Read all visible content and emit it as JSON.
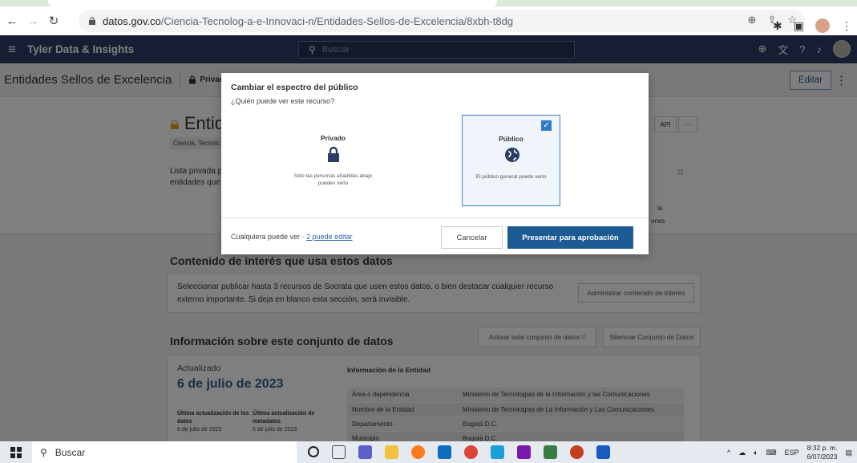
{
  "browser": {
    "url_host": "datos.gov.co",
    "url_path": "/Ciencia-Tecnolog-a-e-Innovaci-n/Entidades-Sellos-de-Excelencia/8xbh-t8dg"
  },
  "header": {
    "brand": "Tyler Data & Insights",
    "search_placeholder": "Buscar"
  },
  "assetbar": {
    "title": "Entidades Sellos de Excelencia",
    "privacy": "Privad",
    "edit_label": "Editar"
  },
  "hero": {
    "title_fragment": "Entid",
    "tag": "Ciencia, Tecnolc",
    "desc_line1": "Lista privada p",
    "desc_line2": "entidades que",
    "api_label": "API",
    "more_label": "···",
    "frag1": "la",
    "frag2": "ones"
  },
  "section1": {
    "title": "Contenido de interés que usa estos datos",
    "text": "Seleccionar publicar hasta 3 recursos de Socrata que usen estos datos, o bien destacar cualquier recurso externo importante. Si deja en blanco esta sección, será invisible.",
    "button": "Administrar contenido de interés"
  },
  "section2": {
    "title": "Información sobre este conjunto de datos",
    "activate_button": "Activar este conjunto de datos",
    "mute_button": "Silenciar Conjunto de Datos",
    "updated_label": "Actualizado",
    "updated_date": "6 de julio de 2023",
    "last_data_label": "Última actualización de los datos",
    "last_data_value": "6 de julio de 2023",
    "last_meta_label": "Última actualización de metadatos",
    "last_meta_value": "6 de julio de 2023",
    "entity_title": "Información de la Entidad",
    "entity_rows": [
      {
        "k": "Área o dependencia",
        "v": "Ministerio de Tecnologías de la Información y las Comunicaciones"
      },
      {
        "k": "Nombre de la Entidad",
        "v": "Ministerio de Tecnologías de La Información y Las Comunicaciones"
      },
      {
        "k": "Departamento",
        "v": "Bogotá D.C."
      },
      {
        "k": "Municipio",
        "v": "Bogotá D.C."
      }
    ]
  },
  "modal": {
    "title": "Cambiar el espectro del público",
    "subtitle": "¿Quién puede ver este recurso?",
    "private_label": "Privado",
    "private_desc": "Sólo las personas añadidas abajo pueden verlo",
    "public_label": "Público",
    "public_desc": "El público general puede verlo",
    "public_selected": true,
    "footer_text": "Cualquiera puede ver · ",
    "footer_link": "2 puede editar",
    "cancel_label": "Cancelar",
    "submit_label": "Presentar para aprobación"
  },
  "taskbar": {
    "search_label": "Buscar",
    "lang": "ESP",
    "time": "8:32 p. m.",
    "date": "6/07/2023"
  },
  "colors": {
    "header_bg": "#2b3d66",
    "primary_button": "#1d5b94",
    "selected_border": "#3a82c4",
    "lock_orange": "#e8a21a"
  }
}
